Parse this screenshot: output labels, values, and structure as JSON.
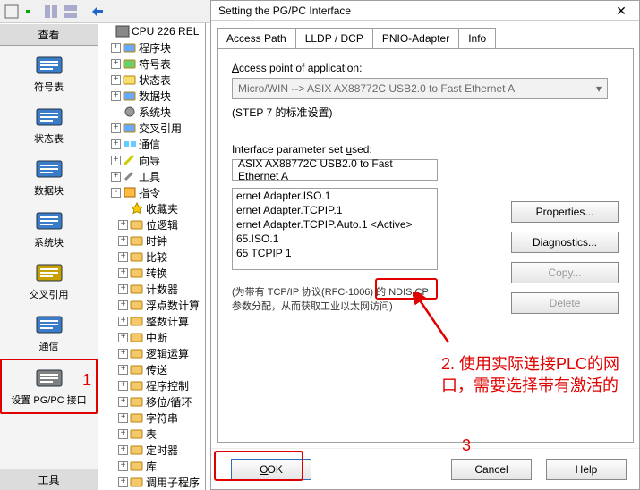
{
  "left": {
    "header": "查看",
    "items": [
      {
        "label": "符号表",
        "name": "symbol-table"
      },
      {
        "label": "状态表",
        "name": "status-table"
      },
      {
        "label": "数据块",
        "name": "data-block"
      },
      {
        "label": "系统块",
        "name": "system-block"
      },
      {
        "label": "交叉引用",
        "name": "cross-ref"
      },
      {
        "label": "通信",
        "name": "communication"
      },
      {
        "label": "设置 PG/PC 接口",
        "name": "pg-pc-interface"
      }
    ],
    "footer": "工具"
  },
  "tree": [
    {
      "exp": "",
      "icon": "cpu",
      "label": "CPU 226 REL"
    },
    {
      "exp": "+",
      "icon": "folder-b",
      "label": "程序块"
    },
    {
      "exp": "+",
      "icon": "folder-g",
      "label": "符号表"
    },
    {
      "exp": "+",
      "icon": "folder-y",
      "label": "状态表"
    },
    {
      "exp": "+",
      "icon": "folder-b",
      "label": "数据块"
    },
    {
      "exp": "",
      "icon": "gear",
      "label": "系统块"
    },
    {
      "exp": "+",
      "icon": "folder-b",
      "label": "交叉引用"
    },
    {
      "exp": "+",
      "icon": "comm",
      "label": "通信"
    },
    {
      "exp": "+",
      "icon": "wiz",
      "label": "向导"
    },
    {
      "exp": "+",
      "icon": "tool",
      "label": "工具"
    },
    {
      "exp": "-",
      "icon": "inst",
      "label": "指令"
    },
    {
      "exp": "",
      "icon": "fav",
      "label": "收藏夹"
    },
    {
      "exp": "+",
      "icon": "folder",
      "label": "位逻辑"
    },
    {
      "exp": "+",
      "icon": "folder",
      "label": "时钟"
    },
    {
      "exp": "+",
      "icon": "folder",
      "label": "比较"
    },
    {
      "exp": "+",
      "icon": "folder",
      "label": "转换"
    },
    {
      "exp": "+",
      "icon": "folder",
      "label": "计数器"
    },
    {
      "exp": "+",
      "icon": "folder",
      "label": "浮点数计算"
    },
    {
      "exp": "+",
      "icon": "folder",
      "label": "整数计算"
    },
    {
      "exp": "+",
      "icon": "folder",
      "label": "中断"
    },
    {
      "exp": "+",
      "icon": "folder",
      "label": "逻辑运算"
    },
    {
      "exp": "+",
      "icon": "folder",
      "label": "传送"
    },
    {
      "exp": "+",
      "icon": "folder",
      "label": "程序控制"
    },
    {
      "exp": "+",
      "icon": "folder",
      "label": "移位/循环"
    },
    {
      "exp": "+",
      "icon": "folder",
      "label": "字符串"
    },
    {
      "exp": "+",
      "icon": "folder",
      "label": "表"
    },
    {
      "exp": "+",
      "icon": "folder",
      "label": "定时器"
    },
    {
      "exp": "+",
      "icon": "folder",
      "label": "库"
    },
    {
      "exp": "+",
      "icon": "folder",
      "label": "调用子程序"
    }
  ],
  "dialog": {
    "title": "Setting the PG/PC Interface",
    "tabs": [
      "Access Path",
      "LLDP / DCP",
      "PNIO-Adapter",
      "Info"
    ],
    "access_label": "Access point of application:",
    "access_value": "Micro/WIN       --> ASIX AX88772C USB2.0 to Fast Ethernet A",
    "standard": "(STEP 7 的标准设置)",
    "iface_label": "Interface parameter set used:",
    "iface_value": "ASIX AX88772C USB2.0 to Fast Ethernet A",
    "list": [
      "ernet Adapter.ISO.1",
      "ernet Adapter.TCPIP.1",
      "ernet Adapter.TCPIP.Auto.1",
      "65.ISO.1",
      "65 TCPIP 1"
    ],
    "active_tag": "<Active>",
    "note": "(为带有 TCP/IP 协议(RFC-1006) 的 NDIS CP 参数分配，从而获取工业以太网访问)",
    "buttons": {
      "properties": "Properties...",
      "diagnostics": "Diagnostics...",
      "copy": "Copy...",
      "delete": "Delete"
    },
    "bottom": {
      "ok": "OK",
      "cancel": "Cancel",
      "help": "Help"
    }
  },
  "annotations": {
    "n1": "1",
    "n2": "2. 使用实际连接PLC的网口，需要选择带有激活的",
    "n3": "3"
  }
}
